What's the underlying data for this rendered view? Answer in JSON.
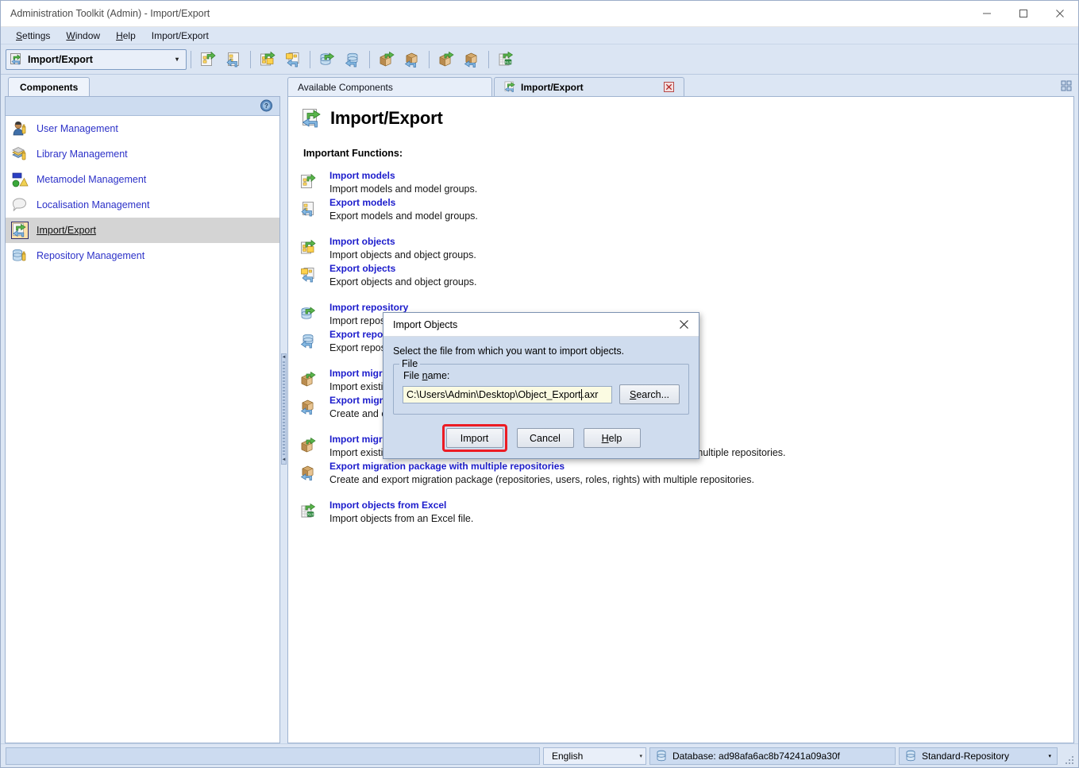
{
  "window": {
    "title": "Administration Toolkit (Admin) - Import/Export",
    "minimize_label": "—",
    "maximize_label": "☐",
    "close_label": "✕"
  },
  "menubar": {
    "items": [
      {
        "label": "Settings",
        "mnemonic": "S"
      },
      {
        "label": "Window",
        "mnemonic": "W"
      },
      {
        "label": "Help",
        "mnemonic": "H"
      },
      {
        "label": "Import/Export",
        "mnemonic": ""
      }
    ]
  },
  "toolbar": {
    "combo_value": "Import/Export",
    "combo_arrow": "▾",
    "buttons": [
      {
        "name": "import-models",
        "icon": "import-model-icon"
      },
      {
        "name": "export-models",
        "icon": "export-model-icon"
      },
      {
        "name": "import-objects",
        "icon": "import-object-icon"
      },
      {
        "name": "export-objects",
        "icon": "export-object-icon"
      },
      {
        "name": "import-repository",
        "icon": "import-repository-icon"
      },
      {
        "name": "export-repository",
        "icon": "export-repository-icon"
      },
      {
        "name": "import-migration-package",
        "icon": "import-package-icon"
      },
      {
        "name": "export-migration-package",
        "icon": "export-package-icon"
      },
      {
        "name": "import-migration-package-multi",
        "icon": "import-package-multi-icon"
      },
      {
        "name": "export-migration-package-multi",
        "icon": "export-package-multi-icon"
      },
      {
        "name": "import-objects-from-excel",
        "icon": "import-excel-icon"
      }
    ]
  },
  "sidebar": {
    "tab_label": "Components",
    "help_tooltip": "Help",
    "items": [
      {
        "label": "User Management",
        "icon": "user-management-icon",
        "selected": false
      },
      {
        "label": "Library Management",
        "icon": "library-management-icon",
        "selected": false
      },
      {
        "label": "Metamodel Management",
        "icon": "metamodel-management-icon",
        "selected": false
      },
      {
        "label": "Localisation Management",
        "icon": "localisation-management-icon",
        "selected": false
      },
      {
        "label": "Import/Export",
        "icon": "import-export-icon",
        "selected": true
      },
      {
        "label": "Repository Management",
        "icon": "repository-management-icon",
        "selected": false
      }
    ]
  },
  "main": {
    "tabs": [
      {
        "label": "Available Components",
        "active": false,
        "closable": false
      },
      {
        "label": "Import/Export",
        "active": true,
        "closable": true,
        "close_label": "☒"
      }
    ],
    "page_title": "Import/Export",
    "section_label": "Important Functions:",
    "functions": [
      {
        "link": "Import models",
        "desc": "Import models and model groups.",
        "icon": "import-model-icon",
        "group": 1
      },
      {
        "link": "Export models",
        "desc": "Export models and model groups.",
        "icon": "export-model-icon",
        "group": 1
      },
      {
        "link": "Import objects",
        "desc": "Import objects and object groups.",
        "icon": "import-object-icon",
        "group": 2
      },
      {
        "link": "Export objects",
        "desc": "Export objects and object groups.",
        "icon": "export-object-icon",
        "group": 2
      },
      {
        "link": "Import repository",
        "desc": "Import repository.",
        "icon": "import-repository-icon",
        "group": 3
      },
      {
        "link": "Export repository",
        "desc": "Export repository.",
        "icon": "export-repository-icon",
        "group": 3
      },
      {
        "link": "Import migration package",
        "desc": "Import existing migration package (repository, users, roles, rights).",
        "icon": "import-package-icon",
        "group": 4
      },
      {
        "link": "Export migration package",
        "desc": "Create and export migration package (repository, users, roles, rights).",
        "icon": "export-package-icon",
        "group": 4
      },
      {
        "link": "Import migration package with multiple repositories",
        "desc": "Import existing repository migration package (repositories, users, roles, rights) with multiple repositories.",
        "icon": "import-package-multi-icon",
        "group": 5
      },
      {
        "link": "Export migration package with multiple repositories",
        "desc": "Create and export migration package (repositories, users, roles, rights) with multiple repositories.",
        "icon": "export-package-multi-icon",
        "group": 5
      },
      {
        "link": "Import objects from Excel",
        "desc": "Import objects from an Excel file.",
        "icon": "import-excel-icon",
        "group": 6
      }
    ]
  },
  "dialog": {
    "title": "Import Objects",
    "close_label": "✕",
    "intro": "Select the file from which you want to import objects.",
    "fieldset_legend": "File",
    "file_label": "File name:",
    "file_value_before_caret": "C:\\Users\\Admin\\Desktop\\Object_Export",
    "file_value_after_caret": ".axr",
    "file_value": "C:\\Users\\Admin\\Desktop\\Object_Export.axr",
    "search_button": "Search...",
    "import_button": "Import",
    "cancel_button": "Cancel",
    "help_button": "Help",
    "highlight_color": "#ec1c24"
  },
  "statusbar": {
    "language": "English",
    "language_arrow": "▾",
    "database": "Database: ad98afa6ac8b74241a09a30f",
    "repository": "Standard-Repository",
    "repository_arrow": "▾"
  }
}
